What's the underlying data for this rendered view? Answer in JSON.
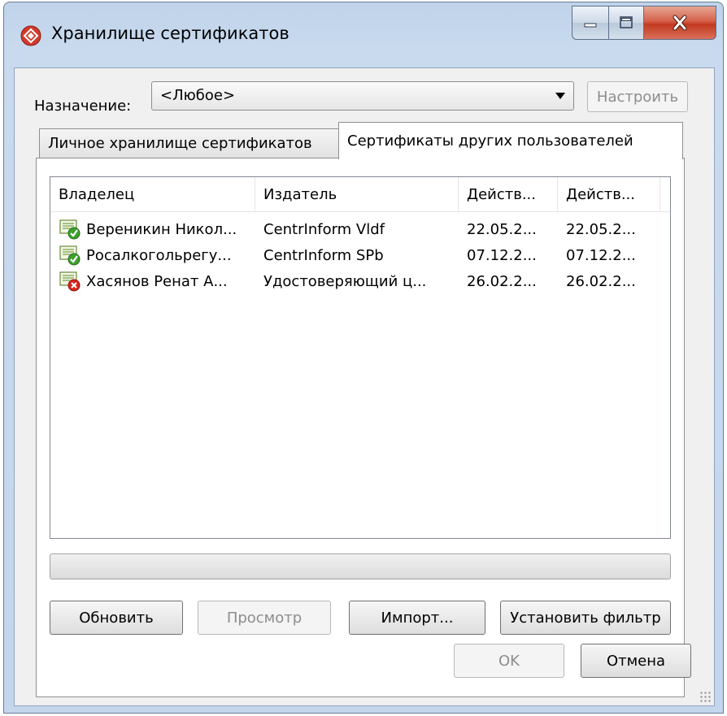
{
  "window": {
    "title": "Хранилище сертификатов",
    "icons": {
      "app": "certificate-store-icon",
      "minimize": "minimize-icon",
      "maximize": "maximize-icon",
      "close": "close-icon"
    }
  },
  "purpose": {
    "label": "Назначение:",
    "selected": "<Любое>",
    "configure_label": "Настроить"
  },
  "tabs": [
    {
      "label": "Личное хранилище сертификатов",
      "active": false
    },
    {
      "label": "Сертификаты других пользователей",
      "active": true
    }
  ],
  "list": {
    "columns": [
      "Владелец",
      "Издатель",
      "Действ...",
      "Действ..."
    ],
    "rows": [
      {
        "owner": "Вереникин Никол...",
        "issuer": "CentrInform Vldf",
        "valid_from": "22.05.2...",
        "valid_to": "22.05.2...",
        "status": "valid",
        "icon": "certificate-valid-icon"
      },
      {
        "owner": "Росалкогольрегу...",
        "issuer": "CentrInform SPb",
        "valid_from": "07.12.2...",
        "valid_to": "07.12.2...",
        "status": "valid",
        "icon": "certificate-valid-icon"
      },
      {
        "owner": "Хасянов Ренат А...",
        "issuer": "Удостоверяющий ц...",
        "valid_from": "26.02.2...",
        "valid_to": "26.02.2...",
        "status": "invalid",
        "icon": "certificate-invalid-icon"
      }
    ]
  },
  "buttons": {
    "refresh": "Обновить",
    "view": "Просмотр",
    "import": "Импорт...",
    "filter": "Установить фильтр",
    "ok": "OK",
    "cancel": "Отмена"
  },
  "colors": {
    "valid": "#3fa02d",
    "invalid": "#d8261b",
    "close_button": "#c9432a"
  }
}
